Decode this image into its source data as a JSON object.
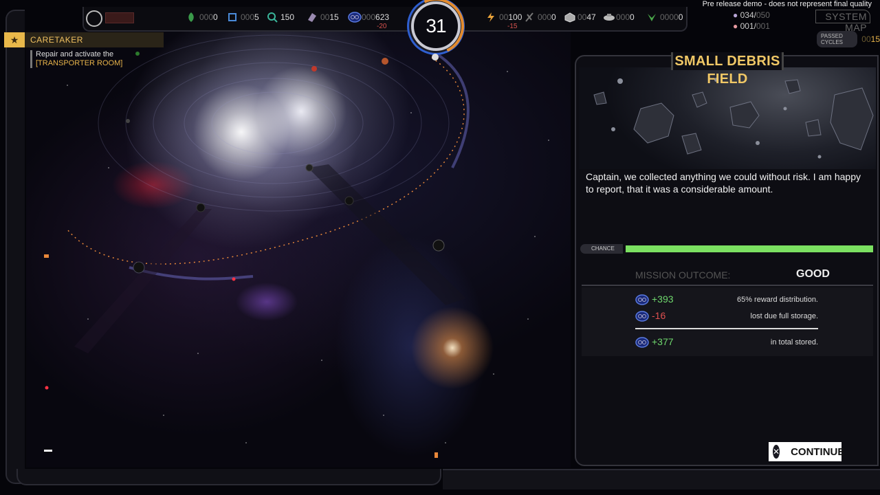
{
  "demo_notice": "Pre release demo - does not represent final quality",
  "top_resources": [
    {
      "name": "dilithium",
      "dim": "000",
      "val": "0",
      "icon": "leaf-icon"
    },
    {
      "name": "chips",
      "dim": "000",
      "val": "5",
      "icon": "chip-icon"
    },
    {
      "name": "research",
      "dim": "",
      "val": "150",
      "icon": "research-icon"
    },
    {
      "name": "crystals",
      "dim": "00",
      "val": "15",
      "icon": "crystal-icon"
    },
    {
      "name": "credits",
      "dim": "000",
      "val": "623",
      "delta": "-20",
      "icon": "credits-icon"
    },
    {
      "name": "energy",
      "dim": "00",
      "val": "100",
      "delta": "-15",
      "icon": "energy-icon"
    },
    {
      "name": "parts",
      "dim": "000",
      "val": "0",
      "icon": "parts-icon"
    },
    {
      "name": "cargo",
      "dim": "00",
      "val": "47",
      "icon": "cargo-icon"
    },
    {
      "name": "ships",
      "dim": "000",
      "val": "0",
      "icon": "ship-icon"
    },
    {
      "name": "staff",
      "dim": "0000",
      "val": "0",
      "icon": "insignia-icon"
    }
  ],
  "turn": "31",
  "crew": {
    "officers": "034/",
    "officers_max": "050",
    "special": "001/",
    "special_max": "001"
  },
  "system_map": "SYSTEM MAP",
  "passed_cycles": {
    "label": "PASSED CYCLES",
    "dim": "00",
    "val": "15"
  },
  "objective": {
    "title": "CARETAKER",
    "line1": "Repair and activate the",
    "line2": "[TRANSPORTER ROOM]"
  },
  "mission": {
    "title": "SMALL DEBRIS FIELD",
    "text": "Captain, we collected anything we could without risk. I am happy to report, that it was a considerable amount.",
    "chance_label": "CHANCE",
    "chance": 1.0,
    "outcome_label": "MISSION OUTCOME:",
    "outcome_value": "GOOD",
    "results": [
      {
        "amount": "+393",
        "desc": "65% reward distribution.",
        "kind": "pos"
      },
      {
        "amount": "-16",
        "desc": "lost due full storage.",
        "kind": "neg"
      }
    ],
    "total": {
      "amount": "+377",
      "desc": "in total stored."
    },
    "continue_label": "CONTINUE"
  },
  "colors": {
    "accent": "#f1c866",
    "good": "#6fd86d",
    "bad": "#e05050",
    "chance": "#7be061",
    "turn_ring": "#2f5fd0"
  }
}
